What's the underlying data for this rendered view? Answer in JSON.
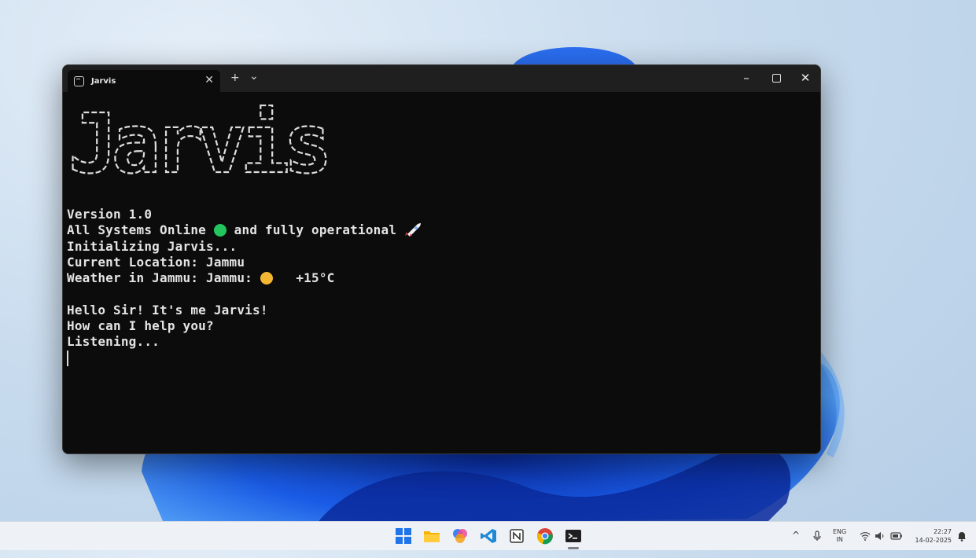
{
  "colors": {
    "online_dot": "#22c55e",
    "weather_sun": "#f5b731",
    "terminal_bg": "#0c0c0c",
    "terminal_text": "#e4e4e4"
  },
  "window": {
    "tab_title": "Jarvis",
    "tab_icon": "terminal-icon",
    "new_tab": "+",
    "dropdown": "⌄",
    "close_tab": "✕",
    "minimize": "–",
    "close": "✕"
  },
  "banner": {
    "text": "Jarvis"
  },
  "console": {
    "version": "Version 1.0",
    "status_prefix": "All Systems Online ",
    "status_suffix": " and fully operational ",
    "status_icon": "rocket-icon",
    "init": "Initializing Jarvis...",
    "location": "Current Location: Jammu",
    "weather_prefix": "Weather in Jammu: Jammu: ",
    "weather_temp": "+15°C",
    "weather_icon": "sun-icon",
    "greeting": "Hello Sir! It's me Jarvis!",
    "help": "How can I help you?",
    "listening": "Listening..."
  },
  "taskbar": {
    "apps": [
      "windows-start-icon",
      "file-explorer-icon",
      "copilot-icon",
      "vscode-icon",
      "notion-icon",
      "chrome-icon",
      "terminal-icon"
    ],
    "language": "ENG",
    "region": "IN",
    "time": "22:27",
    "date": "14-02-2025"
  }
}
